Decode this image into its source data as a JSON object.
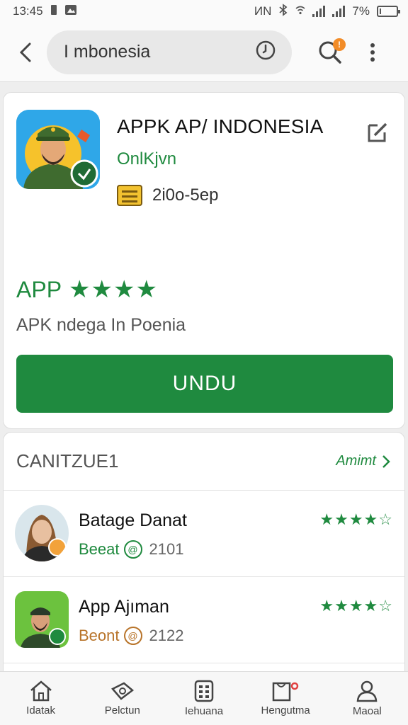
{
  "status_bar": {
    "time": "13:45",
    "network_text": "ИN",
    "battery": "7%",
    "battery_level": 0.07
  },
  "search": {
    "query": "I mbonesia"
  },
  "notification_badge": "!",
  "app": {
    "title": "APPK AP/ INDONESIA",
    "developer": "OnlKjvn",
    "meta": "2i0o-5ep",
    "rating_label": "APP",
    "stars": "★★★★",
    "description": "APK ndega In Poenia",
    "download_label": "UNDU"
  },
  "related": {
    "title": "CANITZUE1",
    "see_all": "Amimt",
    "items": [
      {
        "name": "Batage Danat",
        "tag": "Beeat",
        "count": "2101",
        "stars": "★★★★",
        "empty_star": "☆",
        "tag_color": "#1f8a3f"
      },
      {
        "name": "App Ajıman",
        "tag": "Beont",
        "count": "2122",
        "stars": "★★★★",
        "empty_star": "☆",
        "tag_color": "#b8742a"
      }
    ]
  },
  "nav": {
    "items": [
      {
        "label": "Idatak",
        "icon": "home-icon"
      },
      {
        "label": "Pelctun",
        "icon": "ticket-icon"
      },
      {
        "label": "Iehuana",
        "icon": "grid-icon"
      },
      {
        "label": "Hengutma",
        "icon": "cart-icon"
      },
      {
        "label": "Maoal",
        "icon": "profile-icon"
      }
    ]
  },
  "colors": {
    "brand_green": "#1f8a3f",
    "accent_orange": "#f28c28"
  }
}
